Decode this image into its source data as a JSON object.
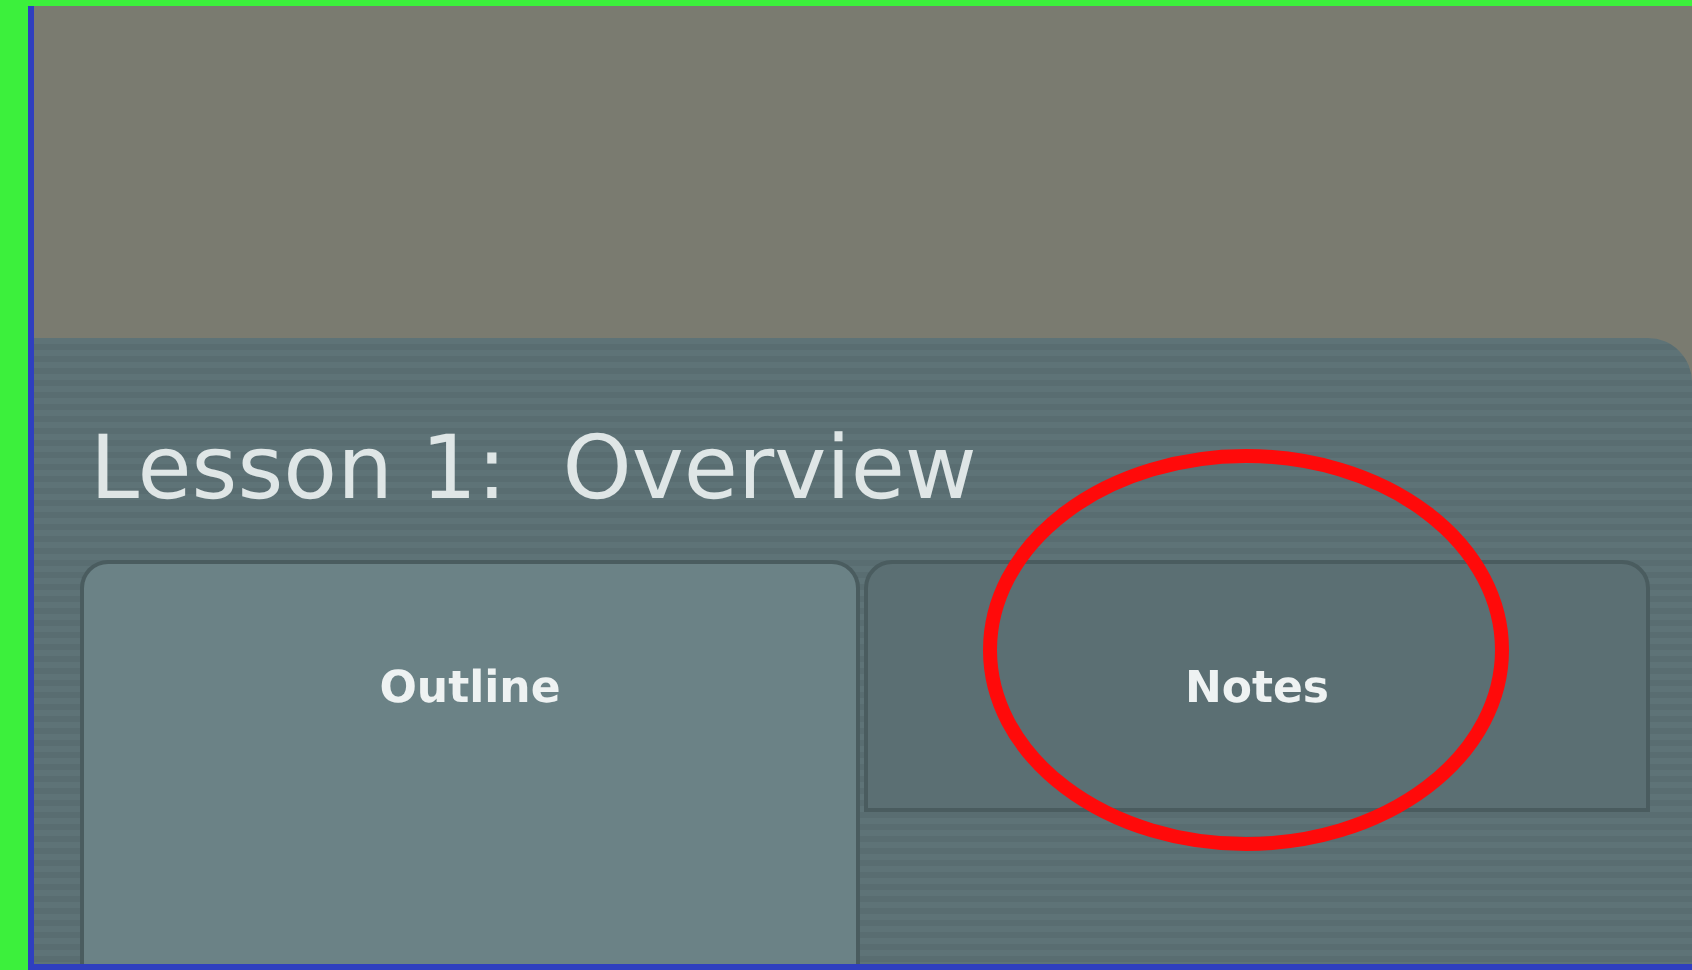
{
  "lesson": {
    "title": "Lesson 1:  Overview"
  },
  "tabs": [
    {
      "label": "Outline",
      "selected": true,
      "circled": false
    },
    {
      "label": "Notes",
      "selected": false,
      "circled": true
    }
  ]
}
